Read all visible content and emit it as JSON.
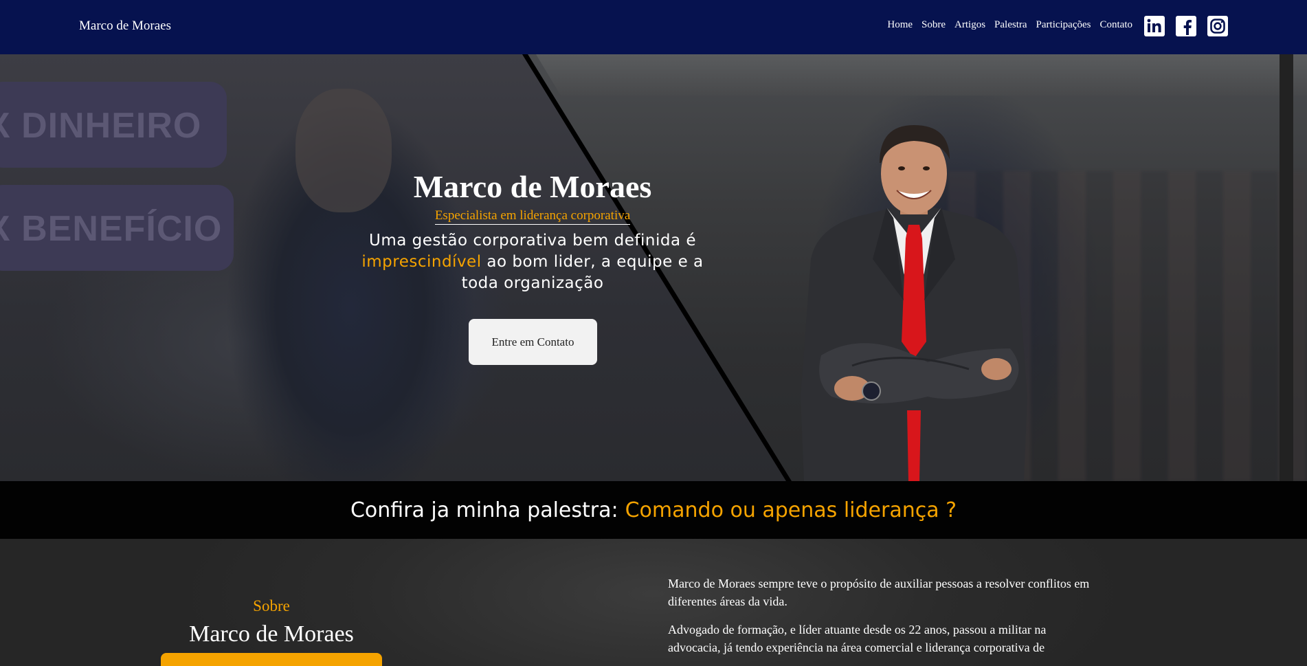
{
  "nav": {
    "brand": "Marco de Moraes",
    "links": [
      "Home",
      "Sobre",
      "Artigos",
      "Palestra",
      "Participações",
      "Contato"
    ],
    "socials": [
      "linkedin-icon",
      "facebook-icon",
      "instagram-icon"
    ]
  },
  "hero": {
    "title": "Marco de Moraes",
    "subtitle": "Especialista em liderança corporativa",
    "tagline_before": "Uma gestão corporativa bem definida é",
    "tagline_highlight": "imprescindível",
    "tagline_after": "ao bom lider, a equipe e a toda organização",
    "cta": "Entre em Contato",
    "background_text_1": "X DINHEIRO",
    "background_text_2": "X BENEFÍCIO"
  },
  "banner": {
    "lead": "Confira ja minha palestra:",
    "highlight": "Comando ou apenas liderança ?"
  },
  "about": {
    "kicker": "Sobre",
    "name": "Marco de Moraes",
    "paragraph1": "Marco de Moraes sempre teve o propósito de auxiliar pessoas a resolver conflitos em diferentes áreas da vida.",
    "paragraph2": "Advogado de formação, e líder atuante desde os 22 anos, passou a militar na advocacia, já tendo experiência na área comercial e liderança corporativa de"
  },
  "colors": {
    "navbar": "#06124f",
    "accent": "#f5a300",
    "banner": "#020202"
  }
}
